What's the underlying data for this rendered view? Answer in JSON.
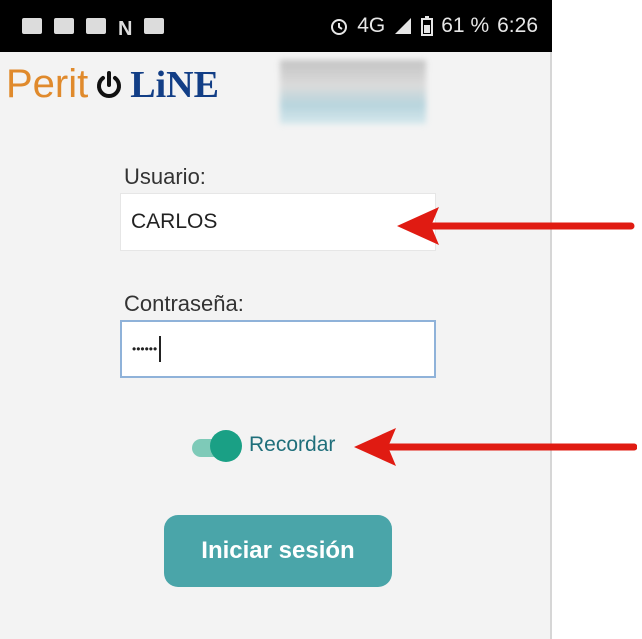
{
  "status_bar": {
    "left_icons": [
      "chat-icon",
      "keyboard-icon",
      "gallery-icon",
      "n-icon",
      "image-icon"
    ],
    "n_glyph": "N",
    "alarm_icon": "alarm-icon",
    "network": "4G",
    "battery": "61 %",
    "time": "6:26"
  },
  "logo": {
    "perit": "Perit",
    "line": "LiNE"
  },
  "login": {
    "username_label": "Usuario:",
    "username_value": "CARLOS",
    "password_label": "Contraseña:",
    "password_value": "••••••",
    "remember_label": "Recordar",
    "remember_on": true,
    "submit_label": "Iniciar sesión"
  },
  "colors": {
    "accent": "#1aa085",
    "button": "#4aa5a9",
    "arrow": "#e01b12",
    "logo_orange": "#e08a2c",
    "logo_blue": "#123e86"
  }
}
